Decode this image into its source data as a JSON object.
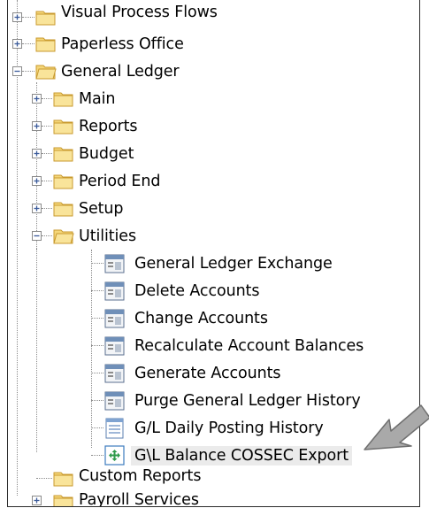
{
  "tree": {
    "items": [
      {
        "label": "Visual Process Flows",
        "state": "collapsed",
        "icon": "folder-icon"
      },
      {
        "label": "Paperless Office",
        "state": "collapsed",
        "icon": "folder-icon"
      },
      {
        "label": "General Ledger",
        "state": "expanded",
        "icon": "folder-icon"
      },
      {
        "label": "Main",
        "state": "collapsed",
        "icon": "folder-icon"
      },
      {
        "label": "Reports",
        "state": "collapsed",
        "icon": "folder-icon"
      },
      {
        "label": "Budget",
        "state": "collapsed",
        "icon": "folder-icon"
      },
      {
        "label": "Period End",
        "state": "collapsed",
        "icon": "folder-icon"
      },
      {
        "label": "Setup",
        "state": "collapsed",
        "icon": "folder-icon"
      },
      {
        "label": "Utilities",
        "state": "expanded",
        "icon": "folder-icon"
      },
      {
        "label": "General Ledger Exchange",
        "icon": "task-window-icon"
      },
      {
        "label": "Delete Accounts",
        "icon": "task-window-icon"
      },
      {
        "label": "Change Accounts",
        "icon": "task-window-icon"
      },
      {
        "label": "Recalculate Account Balances",
        "icon": "task-window-icon"
      },
      {
        "label": "Generate Accounts",
        "icon": "task-window-icon"
      },
      {
        "label": "Purge General Ledger History",
        "icon": "task-window-icon"
      },
      {
        "label": "G/L Daily Posting History",
        "icon": "report-icon"
      },
      {
        "label": "G\\L Balance COSSEC Export",
        "icon": "custom-task-icon",
        "selected": true
      },
      {
        "label": "Custom Reports",
        "icon": "folder-icon"
      },
      {
        "label": "Payroll Services",
        "state": "collapsed",
        "icon": "folder-icon"
      }
    ]
  },
  "annotation": {
    "icon": "pointer-arrow-icon",
    "color": "#a9a9a9"
  },
  "colors": {
    "folder": "#f5d77a",
    "task_window": "#6f8fb8",
    "custom_task": "#2e9a4a"
  }
}
